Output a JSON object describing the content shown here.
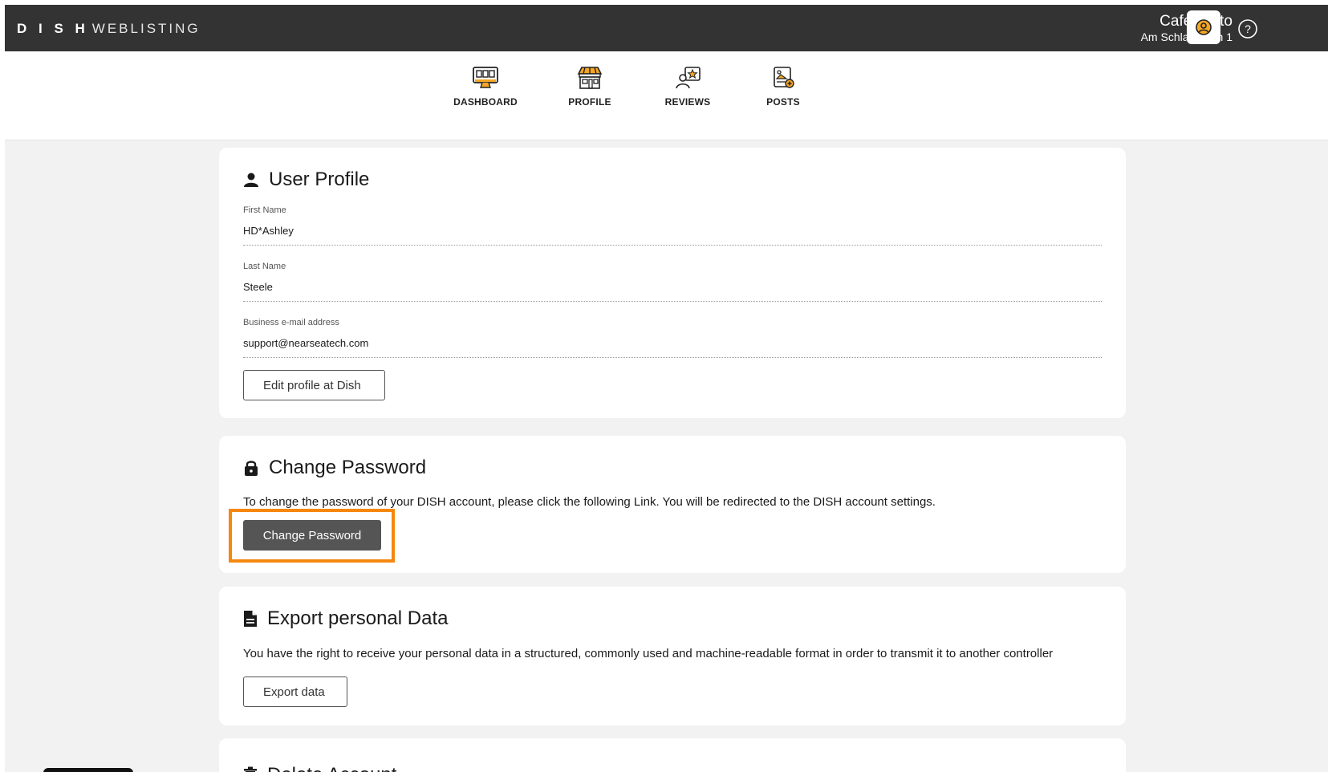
{
  "brand": {
    "bold": "D I S H",
    "light": "WEBLISTING"
  },
  "venue": {
    "name": "Cafe Porto",
    "address": "Am Schlagbaum 1"
  },
  "header_icons": {
    "account": "user-circle-icon",
    "help": "question-circle-icon"
  },
  "nav": {
    "items": [
      {
        "label": "DASHBOARD",
        "icon": "monitor-icon"
      },
      {
        "label": "PROFILE",
        "icon": "storefront-icon"
      },
      {
        "label": "REVIEWS",
        "icon": "review-star-icon"
      },
      {
        "label": "POSTS",
        "icon": "post-add-icon"
      }
    ]
  },
  "user_profile": {
    "title": "User Profile",
    "fields": [
      {
        "label": "First Name",
        "value": "HD*Ashley"
      },
      {
        "label": "Last Name",
        "value": "Steele"
      },
      {
        "label": "Business e-mail address",
        "value": "support@nearseatech.com"
      }
    ],
    "edit_button": "Edit profile at Dish"
  },
  "change_password": {
    "title": "Change Password",
    "description": "To change the password of your DISH account, please click the following Link. You will be redirected to the DISH account settings.",
    "button": "Change Password"
  },
  "export_data": {
    "title": "Export personal Data",
    "description": "You have the right to receive your personal data in a structured, commonly used and machine-readable format in order to transmit it to another controller",
    "button": "Export data"
  },
  "delete_account": {
    "title": "Delete Account"
  },
  "colors": {
    "topbar": "#333333",
    "accent": "#f5a623",
    "highlight": "#f5870f",
    "dark_button": "#555555",
    "background": "#f2f2f2"
  }
}
